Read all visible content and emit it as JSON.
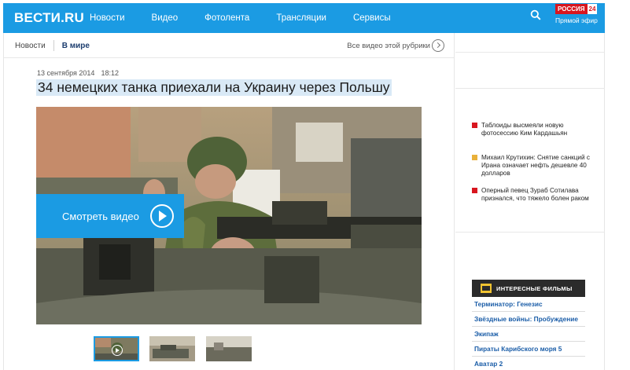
{
  "site": {
    "logo": "ВЕСТИ.RU"
  },
  "nav": [
    "Новости",
    "Видео",
    "Фотолента",
    "Трансляции",
    "Сервисы"
  ],
  "channel": {
    "name": "РОССИЯ",
    "number": "24",
    "subtitle": "Прямой эфир"
  },
  "breadcrumb": {
    "section": "Новости",
    "subsection": "В мире"
  },
  "all_videos_label": "Все видео этой рубрики",
  "article": {
    "date": "13 сентября 2014",
    "time": "18:12",
    "headline": "34 немецких танка приехали на Украину через Польшу"
  },
  "video": {
    "watch_label": "Смотреть видео"
  },
  "side_news": [
    {
      "text": "Таблоиды высмеяли новую фотосессию Ким Кардашьян",
      "color": "#d8161f"
    },
    {
      "text": "Михаил Крутихин: Снятие санкций с Ирана означает нефть дешевле 40 долларов",
      "color": "#e9b13a"
    },
    {
      "text": "Оперный певец Зураб Сотилава признался, что тяжело болен раком",
      "color": "#d8161f"
    }
  ],
  "films": {
    "title": "ИНТЕРЕСНЫЕ ФИЛЬМЫ",
    "items": [
      "Терминатор: Генезис",
      "Звёздные войны: Пробуждение",
      "Экипаж",
      "Пираты Карибского моря 5",
      "Аватар 2"
    ]
  },
  "colors": {
    "brand_blue": "#1b9be3",
    "headline_highlight": "#d9e9f6",
    "film_link": "#1c5ea8"
  }
}
